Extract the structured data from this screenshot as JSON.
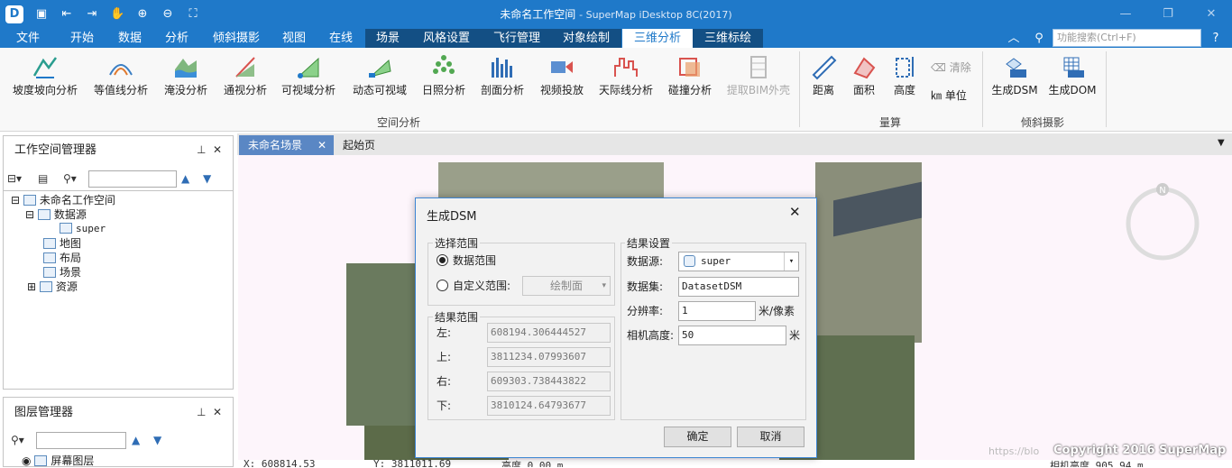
{
  "window": {
    "title": "未命名工作空间",
    "subtitle": "- SuperMap iDesktop 8C(2017)"
  },
  "menu": {
    "items": [
      "文件",
      "开始",
      "数据",
      "分析",
      "倾斜摄影",
      "视图",
      "在线",
      "场景",
      "风格设置",
      "飞行管理",
      "对象绘制",
      "三维分析",
      "三维标绘"
    ]
  },
  "search": {
    "placeholder": "功能搜索(Ctrl+F)"
  },
  "ribbon": {
    "spatial": {
      "buttons": [
        "坡度坡向分析",
        "等值线分析",
        "淹没分析",
        "通视分析",
        "可视域分析",
        "动态可视域",
        "日照分析",
        "剖面分析",
        "视频投放",
        "天际线分析",
        "碰撞分析",
        "提取BIM外壳"
      ],
      "group": "空间分析"
    },
    "measure": {
      "distance": "距离",
      "area": "面积",
      "height": "高度",
      "clear": "清除",
      "unit": "单位",
      "group": "量算"
    },
    "oblique": {
      "dsm": "生成DSM",
      "dom": "生成DOM",
      "group": "倾斜摄影"
    }
  },
  "workspace_panel": {
    "title": "工作空间管理器",
    "tree": [
      "未命名工作空间",
      "数据源",
      "super",
      "地图",
      "布局",
      "场景",
      "资源"
    ]
  },
  "layer_panel": {
    "title": "图层管理器",
    "tree": [
      "屏幕图层"
    ]
  },
  "tabs": {
    "scene": "未命名场景",
    "start": "起始页"
  },
  "compass": {
    "label": "N"
  },
  "dialog": {
    "title": "生成DSM",
    "select_range": {
      "legend": "选择范围",
      "opt1": "数据范围",
      "opt2": "自定义范围:",
      "draw_btn": "绘制面"
    },
    "result_range": {
      "legend": "结果范围",
      "left_label": "左:",
      "left": "608194.306444527",
      "top_label": "上:",
      "top": "3811234.07993607",
      "right_label": "右:",
      "right": "609303.738443822",
      "bottom_label": "下:",
      "bottom": "3810124.64793677"
    },
    "result_settings": {
      "legend": "结果设置",
      "datasource_label": "数据源:",
      "datasource": "super",
      "dataset_label": "数据集:",
      "dataset": "DatasetDSM",
      "resolution_label": "分辨率:",
      "resolution": "1",
      "resolution_unit": "米/像素",
      "cam_label": "相机高度:",
      "cam": "50",
      "cam_unit": "米"
    },
    "ok": "确定",
    "cancel": "取消"
  },
  "status": {
    "x": "X: 608814.53",
    "y": "Y: 3811011.69",
    "h": "高度 0.00 m",
    "cam": "相机高度 905.94 m"
  },
  "watermark": {
    "copyright": "Copyright 2016 SuperMap",
    "blog": "https://blo"
  }
}
